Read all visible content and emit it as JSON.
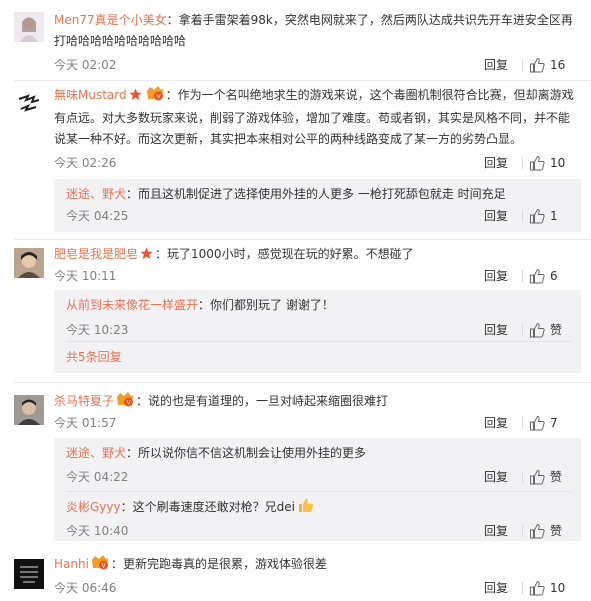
{
  "comments": [
    {
      "user": "Men77真是个小美女",
      "text": "拿着手雷架着98k，突然电网就来了，然后两队达成共识先开车进安全区再打哈哈哈哈哈哈哈哈哈哈",
      "time": "今天 02:02",
      "reply_label": "回复",
      "likes": "16"
    },
    {
      "user": "無味Mustard",
      "text": "作为一个名叫绝地求生的游戏来说，这个毒圈机制很符合比赛，但却离游戏有点远。对大多数玩家来说，削弱了游戏体验，增加了难度。苟或者钢，其实是风格不同，并不能说某一种不好。而这次更新，其实把本来相对公平的两种线路变成了某一方的劣势凸显。",
      "time": "今天 02:26",
      "reply_label": "回复",
      "likes": "10",
      "replies": [
        {
          "user": "迷途、野犬",
          "text": "而且这机制促进了选择使用外挂的人更多  一枪打死舔包就走  时间充足",
          "time": "今天 04:25",
          "reply_label": "回复",
          "likes": "1"
        }
      ]
    },
    {
      "user": "肥皂是我是肥皂",
      "text": "玩了1000小时，感觉现在玩的好累。不想碰了",
      "time": "今天 10:11",
      "reply_label": "回复",
      "likes": "6",
      "replies": [
        {
          "user": "从前到未来像花一样盛开",
          "text": "你们都别玩了 谢谢了！",
          "time": "今天 10:23",
          "reply_label": "回复",
          "likes": "赞"
        }
      ],
      "more_replies": "共5条回复"
    },
    {
      "user": "杀马特夏子",
      "text": "说的也是有道理的，一旦对峙起来缩圈很难打",
      "time": "今天 01:57",
      "reply_label": "回复",
      "likes": "7",
      "replies": [
        {
          "user": "迷途、野犬",
          "text": "所以说你信不信这机制会让使用外挂的更多",
          "time": "今天 04:22",
          "reply_label": "回复",
          "likes": "赞"
        },
        {
          "user": "炎彬Gyyy",
          "text": "这个刷毒速度还敢对枪？兄dei",
          "time": "今天 10:40",
          "reply_label": "回复",
          "likes": "赞"
        }
      ]
    },
    {
      "user": "Hanhi",
      "text": "更新完跑毒真的是很累，游戏体验很差",
      "time": "今天 06:46",
      "reply_label": "回复",
      "likes": "10"
    }
  ],
  "colors": {
    "username": "#eb7350",
    "time": "#808080",
    "reply_background": "#f2f2f5",
    "vip_badge": "#e8541c",
    "star": "#f0512c"
  },
  "icons": [
    "like-thumb-icon",
    "vip-badge-icon",
    "star-icon",
    "thumbs-up-emoji-icon"
  ]
}
